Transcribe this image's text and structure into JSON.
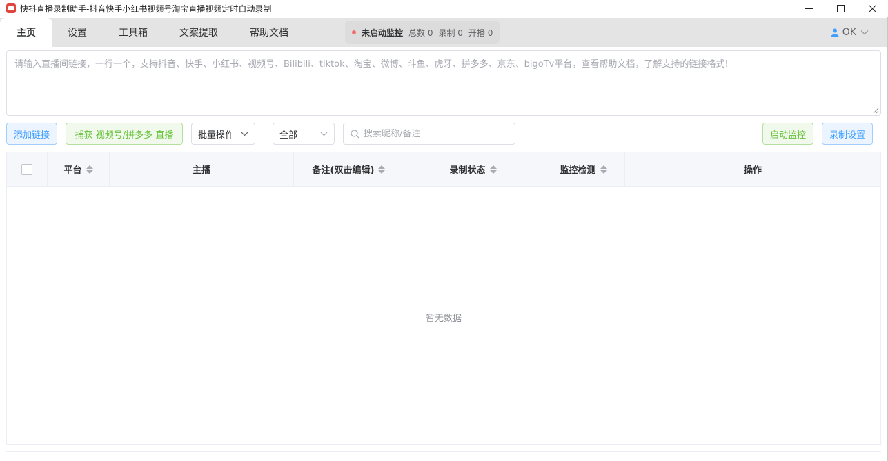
{
  "window": {
    "title": "快抖直播录制助手-抖音快手小红书视频号淘宝直播视频定时自动录制"
  },
  "tabs": [
    {
      "label": "主页",
      "active": true
    },
    {
      "label": "设置"
    },
    {
      "label": "工具箱"
    },
    {
      "label": "文案提取"
    },
    {
      "label": "帮助文档"
    }
  ],
  "status": {
    "main": "未启动监控",
    "total": "总数 0",
    "recording": "录制 0",
    "live": "开播 0"
  },
  "user": {
    "name": "OK"
  },
  "link_input": {
    "placeholder": "请输入直播间链接，一行一个，支持抖音、快手、小红书、视频号、Bilibili、tiktok、淘宝、微博、斗鱼、虎牙、拼多多、京东、bigoTv平台，查看帮助文档，了解支持的链接格式!",
    "value": ""
  },
  "toolbar": {
    "add_link": "添加链接",
    "capture": "捕获 视频号/拼多多 直播",
    "batch": "批量操作",
    "filter": "全部",
    "search_placeholder": "搜索昵称/备注",
    "start_monitor": "启动监控",
    "record_settings": "录制设置"
  },
  "table": {
    "columns": [
      "平台",
      "主播",
      "备注(双击编辑)",
      "录制状态",
      "监控检测",
      "操作"
    ],
    "rows": [],
    "empty_text": "暂无数据"
  },
  "colors": {
    "primary": "#409eff",
    "success": "#67c23a",
    "status_dot": "#f56c6c"
  }
}
